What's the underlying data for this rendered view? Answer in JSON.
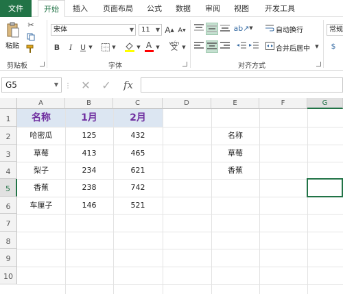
{
  "tabs": [
    "文件",
    "开始",
    "插入",
    "页面布局",
    "公式",
    "数据",
    "审阅",
    "视图",
    "开发工具"
  ],
  "ribbon": {
    "clipboard": {
      "paste_label": "粘贴",
      "group_label": "剪贴板"
    },
    "font": {
      "font_name": "宋体",
      "font_size": "11",
      "bold": "B",
      "italic": "I",
      "underline": "U",
      "group_label": "字体",
      "grow": "A",
      "shrink": "A",
      "font_color_letter": "A",
      "wen": "wén"
    },
    "alignment": {
      "wrap_text": "自动换行",
      "merge_center": "合并后居中",
      "group_label": "对齐方式"
    },
    "number": {
      "format": "常规"
    }
  },
  "formula_bar": {
    "name_box": "G5",
    "fx": "fx",
    "content": ""
  },
  "columns": [
    "A",
    "B",
    "C",
    "D",
    "E",
    "F",
    "G"
  ],
  "rows": [
    "1",
    "2",
    "3",
    "4",
    "5",
    "6",
    "7",
    "8",
    "9",
    "10"
  ],
  "table": {
    "headers": [
      "名称",
      "1月",
      "2月"
    ],
    "rows": [
      [
        "哈密瓜",
        "125",
        "432"
      ],
      [
        "草莓",
        "413",
        "465"
      ],
      [
        "梨子",
        "234",
        "621"
      ],
      [
        "香蕉",
        "238",
        "742"
      ],
      [
        "车厘子",
        "146",
        "521"
      ]
    ]
  },
  "lookup": [
    "名称",
    "草莓",
    "香蕉"
  ],
  "colors": {
    "accent": "#217346",
    "header_fill": "#dce6f2",
    "header_text": "#7030a0"
  }
}
